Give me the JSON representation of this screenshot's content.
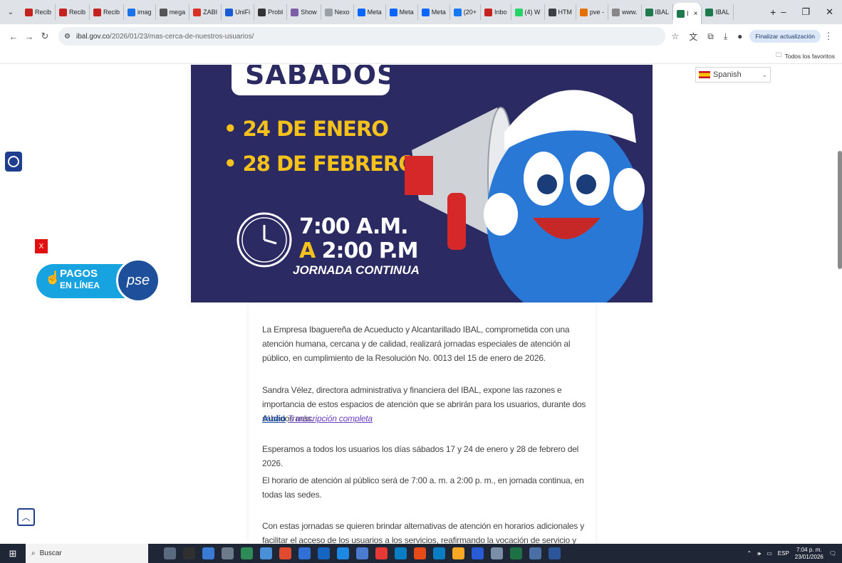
{
  "browser": {
    "tabs": [
      {
        "label": "Recib",
        "color": "#c5221f"
      },
      {
        "label": "Recib",
        "color": "#c5221f"
      },
      {
        "label": "Recib",
        "color": "#c5221f"
      },
      {
        "label": "imag",
        "color": "#1a73e8"
      },
      {
        "label": "mega",
        "color": "#555555"
      },
      {
        "label": "ZABI",
        "color": "#d93025"
      },
      {
        "label": "UniFi",
        "color": "#1a5bd6"
      },
      {
        "label": "Probl",
        "color": "#333333"
      },
      {
        "label": "Show",
        "color": "#7b5ea7"
      },
      {
        "label": "Nexo",
        "color": "#9aa0a6"
      },
      {
        "label": "Meta",
        "color": "#0866ff"
      },
      {
        "label": "Meta",
        "color": "#0866ff"
      },
      {
        "label": "Meta",
        "color": "#0866ff"
      },
      {
        "label": "(20+",
        "color": "#1877f2"
      },
      {
        "label": "Inbo",
        "color": "#c5221f"
      },
      {
        "label": "(4) W",
        "color": "#25d366"
      },
      {
        "label": "HTM",
        "color": "#3c4043"
      },
      {
        "label": "pve -",
        "color": "#e57000"
      },
      {
        "label": "www.",
        "color": "#888888"
      },
      {
        "label": "IBAL",
        "color": "#1e7a4c"
      },
      {
        "label": "I",
        "color": "#1e7a4c",
        "active": true
      },
      {
        "label": "IBAL",
        "color": "#1e7a4c"
      }
    ],
    "url": {
      "host": "ibal.gov.co",
      "path": "/2026/01/23/mas-cerca-de-nuestros-usuarios/"
    },
    "update_button": "Finalizar actualización",
    "bookmarks_folder": "Todos los favoritos"
  },
  "banner": {
    "heading": "SABADOS",
    "date1": "• 24 DE ENERO",
    "date2": "• 28 DE FEBRERO",
    "time1": "7:00 A.M.",
    "time2_prefix": "A",
    "time2": "2:00 P.M",
    "jornada": "JORNADA CONTINUA"
  },
  "language_selector": {
    "value": "Spanish"
  },
  "pagos": {
    "line1": "PAGOS",
    "line2": "EN LÍNEA",
    "pse": "pse",
    "close": "X"
  },
  "article": {
    "p1": "La Empresa Ibaguereña de Acueducto y Alcantarillado IBAL, comprometida con una atención humana, cercana y de calidad, realizará jornadas especiales de atención al público, en cumplimiento de la Resolución No. 0013 del 15 de enero de 2026.",
    "p2": "Sandra Vélez, directora administrativa y financiera del IBAL, expone las razones e importancia de estos espacios de atención que se abrirán para los usuarios, durante dos sábados más.",
    "audio_label": "Audio",
    "transcript_label": "Transcripción completa",
    "p3": "Esperamos a todos los usuarios los días sábados 17 y 24 de enero y 28 de febrero del 2026.",
    "p4": "El horario de atención al público será de 7:00 a. m. a 2:00 p. m., en jornada continua, en todas las sedes.",
    "p5": "Con estas jornadas se quieren brindar alternativas de atención en horarios adicionales y facilitar el acceso de los usuarios a los servicios, reafirmando la vocación de servicio y cercanía con la"
  },
  "taskbar": {
    "search_placeholder": "Buscar",
    "lang": "ESP",
    "time": "7:04 p. m.",
    "date": "23/01/2026",
    "apps": [
      "#5b6b7f",
      "#2f2f2f",
      "#3a7bd5",
      "#6c7a89",
      "#2e8b57",
      "#4a90d9",
      "#e04a2f",
      "#2f6fd6",
      "#1565c0",
      "#1e88e5",
      "#4a7bd0",
      "#e53935",
      "#0b7ec3",
      "#e64a19",
      "#0b7ec3",
      "#f9a825",
      "#2a5bd7",
      "#7a8ea8",
      "#1e7145",
      "#4a6fa5",
      "#2b579a"
    ]
  }
}
